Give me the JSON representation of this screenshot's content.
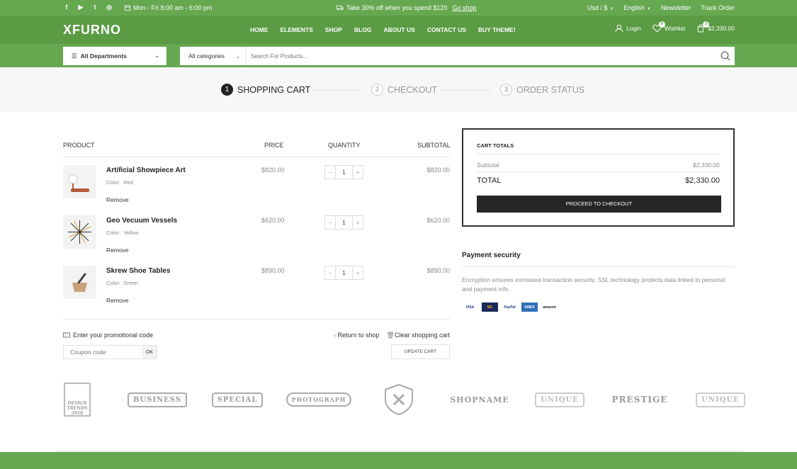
{
  "topbar": {
    "socials": [
      "facebook-icon",
      "youtube-icon",
      "twitter-icon",
      "instagram-icon"
    ],
    "hours": "Mon - Fri 8:00 am - 6:00 pm",
    "promo_text": "Take 30% off when you spend $120",
    "promo_link": "Go shop",
    "currency": "Usd / $",
    "language": "English",
    "newsletter": "Newsletter",
    "track": "Track Order"
  },
  "header": {
    "logo": "XFURNO",
    "nav": [
      "HOME",
      "ELEMENTS",
      "SHOP",
      "BLOG",
      "ABOUT US",
      "CONTACT US",
      "BUY THEME!"
    ],
    "login": "Login",
    "wishlist": "Wishlist",
    "wishlist_count": "0",
    "cart_count": "3",
    "cart_total": "$2,330.00"
  },
  "search": {
    "departments": "All Departments",
    "category": "All categories",
    "placeholder": "Search For Products..."
  },
  "steps": [
    {
      "num": "1",
      "label": "SHOPPING CART"
    },
    {
      "num": "2",
      "label": "CHECKOUT"
    },
    {
      "num": "3",
      "label": "ORDER STATUS"
    }
  ],
  "table": {
    "headers": {
      "product": "PRODUCT",
      "price": "PRICE",
      "quantity": "QUANTITY",
      "subtotal": "SUBTOTAL"
    },
    "color_label": "Color:",
    "remove": "Remove",
    "rows": [
      {
        "name": "Artificial Showpiece Art",
        "color": "Red",
        "price": "$820.00",
        "qty": "1",
        "subtotal": "$820.00"
      },
      {
        "name": "Geo Vecuum Vessels",
        "color": "Yellow",
        "price": "$620.00",
        "qty": "1",
        "subtotal": "$620.00"
      },
      {
        "name": "Skrew Shoe Tables",
        "color": "Green",
        "price": "$890.00",
        "qty": "1",
        "subtotal": "$890.00"
      }
    ]
  },
  "coupon": {
    "label": "Enter your promotional code",
    "placeholder": "Coupon code",
    "ok": "OK"
  },
  "actions": {
    "return": "Return to shop",
    "clear": "Clear shopping cart",
    "update": "UPDATE CART"
  },
  "totals": {
    "title": "CART TOTALS",
    "subtotal_label": "Subtotal",
    "subtotal_value": "$2,330.00",
    "total_label": "TOTAL",
    "total_value": "$2,330.00",
    "checkout": "PROCEED TO CHECKOUT"
  },
  "payment": {
    "title": "Payment security",
    "text": "Encryption ensures increased transaction security. SSL technology protects data linked to personal and payment info.",
    "cards": [
      "VISA",
      "MC",
      "PayPal",
      "AMEX",
      "amazon"
    ]
  },
  "brands": [
    "DESIGN TRENDS 2018",
    "BUSINESS",
    "SPECIAL",
    "PHOTOGRAPH",
    "",
    "SHOPNAME",
    "UNIQUE",
    "PRESTIGE",
    "UNIQUE"
  ],
  "colors": {
    "green": "#66a850",
    "dark_green": "#5a9b44",
    "dark": "#262626"
  }
}
